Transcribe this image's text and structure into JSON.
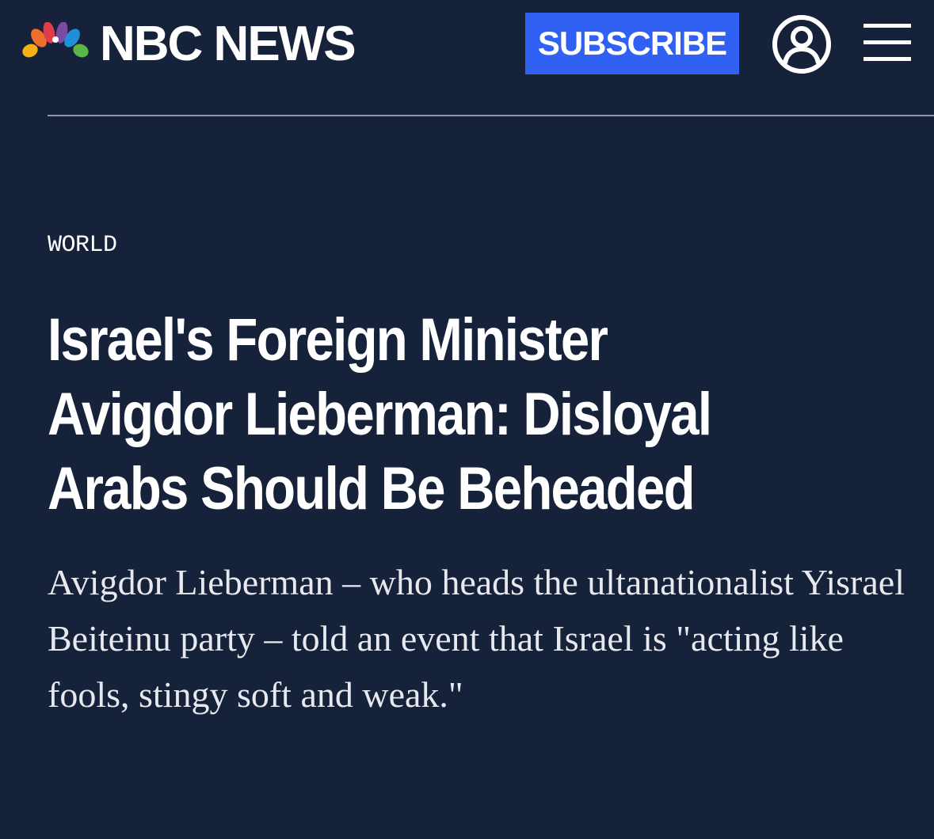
{
  "header": {
    "brand": "NBC NEWS",
    "logo_icon": "nbc-peacock-icon",
    "subscribe_label": "SUBSCRIBE",
    "account_icon": "user-account-icon",
    "menu_icon": "hamburger-menu-icon"
  },
  "article": {
    "section": "WORLD",
    "headline": "Israel's Foreign Minister Avigdor Lieberman: Disloyal Arabs Should Be Beheaded",
    "dek": "Avigdor Lieberman – who heads the ultanationalist Yisrael Beiteinu party – told an event that Israel is \"acting like fools, stingy soft and weak.\""
  },
  "colors": {
    "background": "#16213a",
    "subscribe_button": "#3061f2",
    "divider": "#8e95a4",
    "text": "#ffffff",
    "peacock": [
      "#f6b117",
      "#ee6f2d",
      "#e03d4a",
      "#7b4ba3",
      "#1f8fd6",
      "#5cb646"
    ]
  }
}
